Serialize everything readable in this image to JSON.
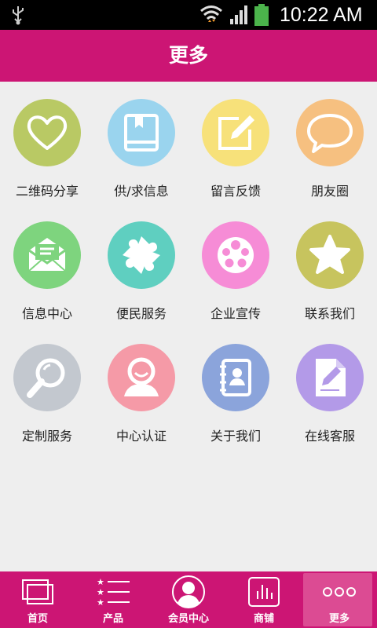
{
  "status": {
    "time": "10:22 AM"
  },
  "header": {
    "title": "更多"
  },
  "colors": {
    "brand": "#cc1574",
    "active_tab": "#dc4b93"
  },
  "grid": [
    {
      "label": "二维码分享",
      "icon": "heart-icon",
      "color": "#b9c964"
    },
    {
      "label": "供/求信息",
      "icon": "book-icon",
      "color": "#9ad4ee"
    },
    {
      "label": "留言反馈",
      "icon": "edit-note-icon",
      "color": "#f7e17a"
    },
    {
      "label": "朋友圈",
      "icon": "chat-bubble-icon",
      "color": "#f6c080"
    },
    {
      "label": "信息中心",
      "icon": "envelope-icon",
      "color": "#7ed47e"
    },
    {
      "label": "便民服务",
      "icon": "puzzle-icon",
      "color": "#5fcfc0"
    },
    {
      "label": "企业宣传",
      "icon": "film-reel-icon",
      "color": "#f68cd6"
    },
    {
      "label": "联系我们",
      "icon": "star-icon",
      "color": "#c7c45e"
    },
    {
      "label": "定制服务",
      "icon": "magnifier-icon",
      "color": "#c3c8cf"
    },
    {
      "label": "中心认证",
      "icon": "user-icon",
      "color": "#f59aa7"
    },
    {
      "label": "关于我们",
      "icon": "contacts-book-icon",
      "color": "#8ba4db"
    },
    {
      "label": "在线客服",
      "icon": "document-edit-icon",
      "color": "#b39ae8"
    }
  ],
  "tabs": [
    {
      "label": "首页",
      "icon": "home-pages-icon"
    },
    {
      "label": "产品",
      "icon": "product-list-icon"
    },
    {
      "label": "会员中心",
      "icon": "member-icon"
    },
    {
      "label": "商铺",
      "icon": "shop-chart-icon"
    },
    {
      "label": "更多",
      "icon": "more-dots-icon",
      "active": true
    }
  ]
}
